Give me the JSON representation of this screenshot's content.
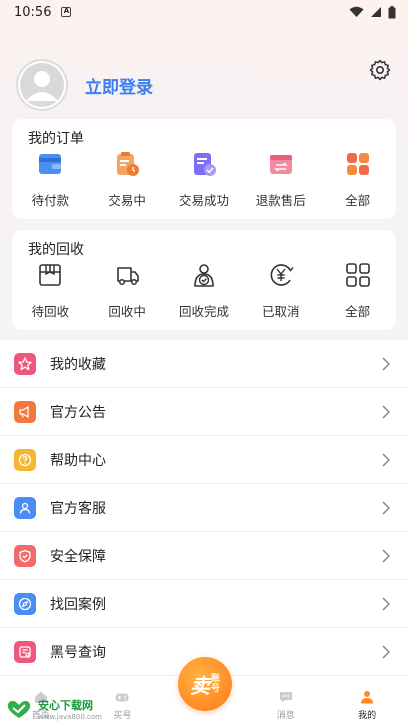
{
  "status_bar": {
    "time": "10:56"
  },
  "profile": {
    "login_text": "立即登录"
  },
  "orders": {
    "title": "我的订单",
    "items": [
      {
        "label": "待付款",
        "icon": "wallet-icon"
      },
      {
        "label": "交易中",
        "icon": "clipboard-clock-icon"
      },
      {
        "label": "交易成功",
        "icon": "document-check-icon"
      },
      {
        "label": "退款售后",
        "icon": "refund-icon"
      },
      {
        "label": "全部",
        "icon": "grid-icon"
      }
    ]
  },
  "recycle": {
    "title": "我的回收",
    "items": [
      {
        "label": "待回收",
        "icon": "box-icon"
      },
      {
        "label": "回收中",
        "icon": "truck-icon"
      },
      {
        "label": "回收完成",
        "icon": "person-check-icon"
      },
      {
        "label": "已取消",
        "icon": "yen-cancel-icon"
      },
      {
        "label": "全部",
        "icon": "grid-icon"
      }
    ]
  },
  "menu": [
    {
      "label": "我的收藏",
      "icon": "star-icon",
      "color": "#f0577f"
    },
    {
      "label": "官方公告",
      "icon": "megaphone-icon",
      "color": "#f2783c"
    },
    {
      "label": "帮助中心",
      "icon": "help-icon",
      "color": "#f5b731"
    },
    {
      "label": "官方客服",
      "icon": "service-icon",
      "color": "#4b8df5"
    },
    {
      "label": "安全保障",
      "icon": "shield-icon",
      "color": "#f26a6a"
    },
    {
      "label": "找回案例",
      "icon": "compass-icon",
      "color": "#4b8df5"
    },
    {
      "label": "黑号查询",
      "icon": "search-list-icon",
      "color": "#f0577f"
    }
  ],
  "tabbar": {
    "tabs": [
      {
        "label": "首页",
        "icon": "home-icon"
      },
      {
        "label": "买号",
        "icon": "gamepad-icon"
      },
      {
        "label": "消息",
        "icon": "message-icon"
      },
      {
        "label": "我的",
        "icon": "user-icon"
      }
    ],
    "sell_button": {
      "big": "卖",
      "small_top": "账",
      "small_bottom": "号"
    }
  },
  "watermark": {
    "title": "安心下载网",
    "url": "www.java800.com"
  },
  "colors": {
    "accent": "#3b7ef0",
    "orange": "#ff8a25"
  }
}
